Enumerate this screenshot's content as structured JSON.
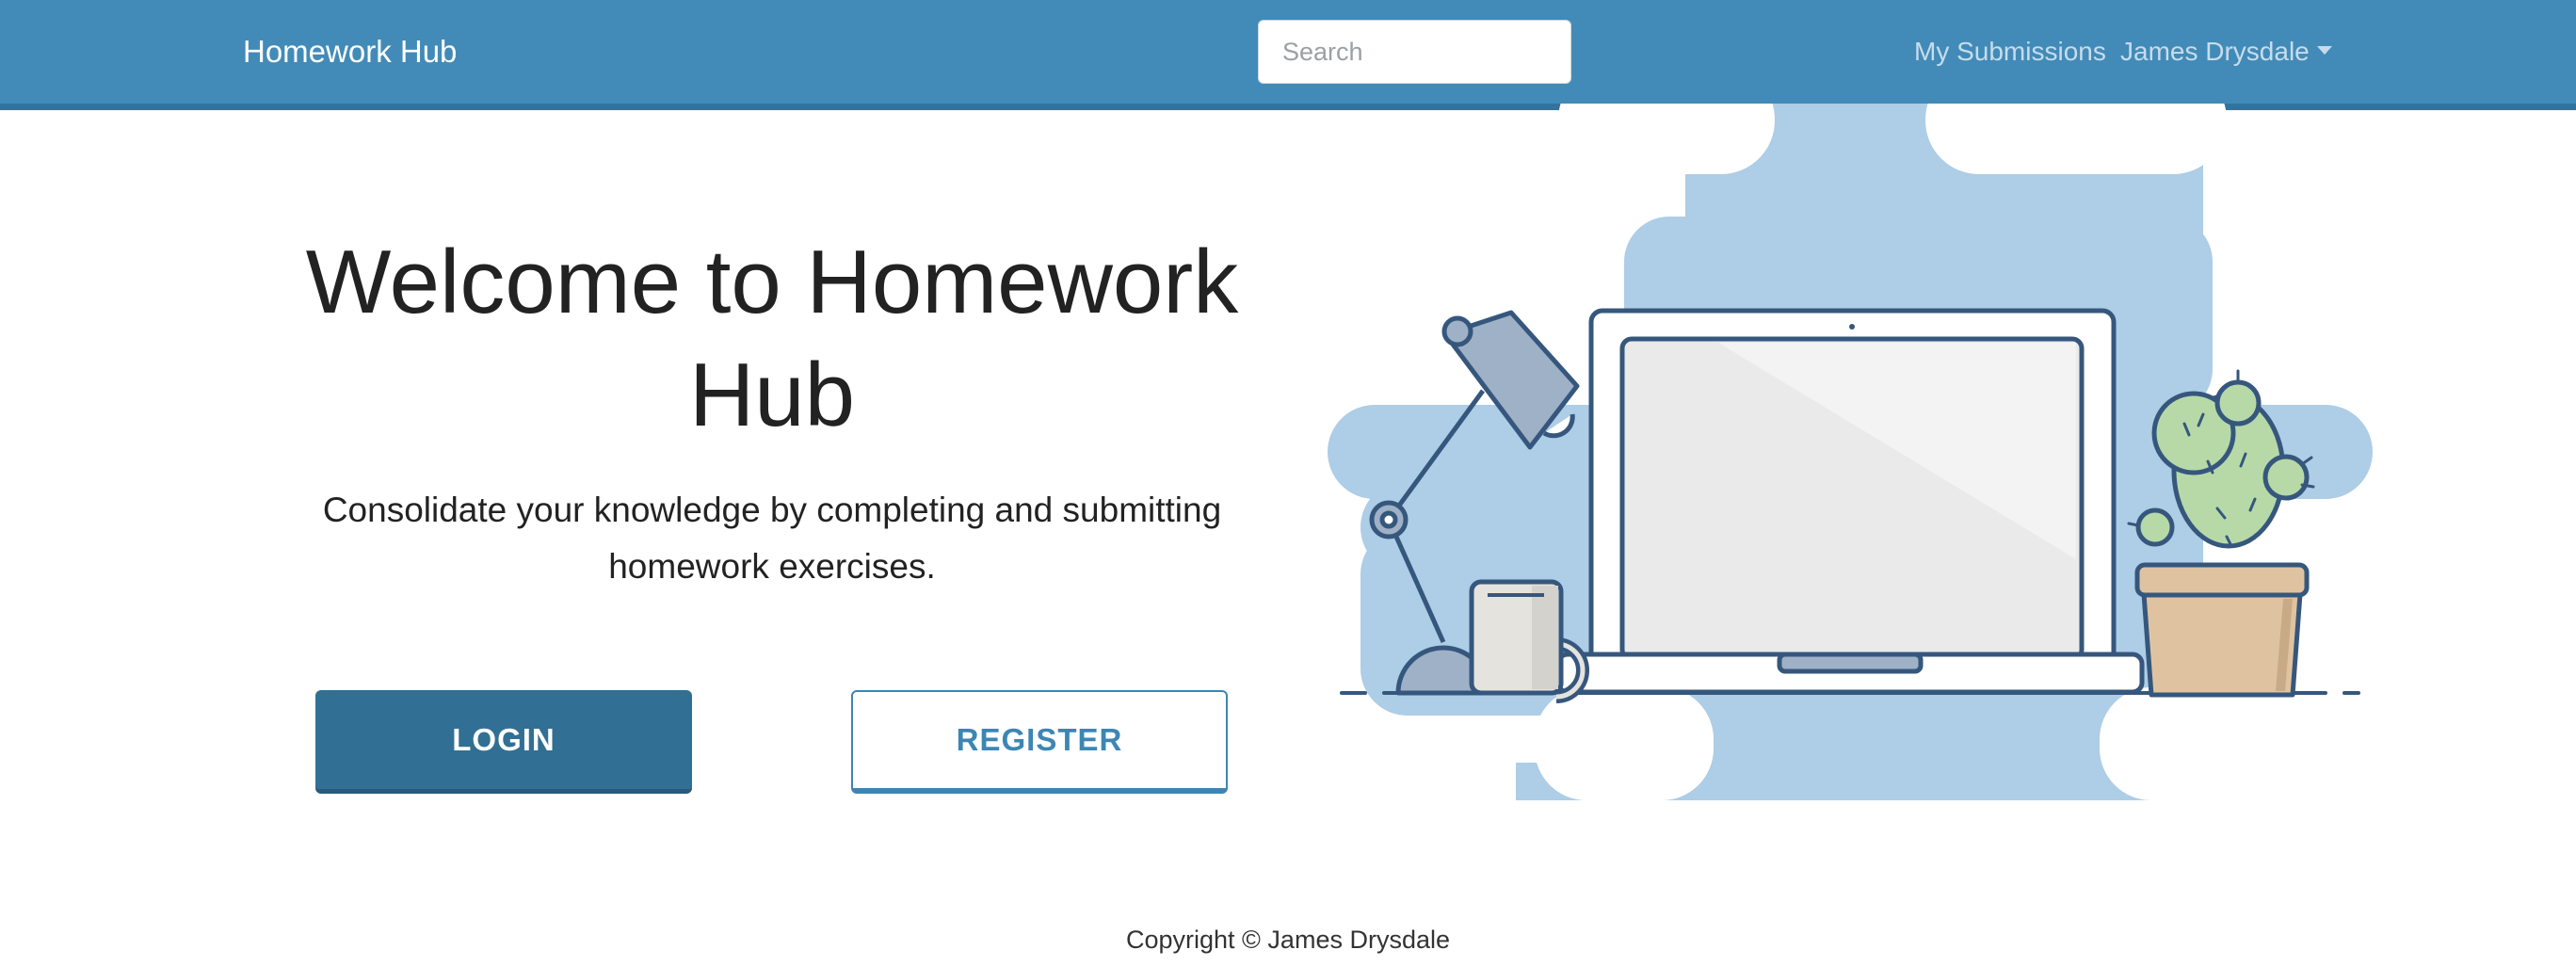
{
  "navbar": {
    "brand": "Homework Hub",
    "search_placeholder": "Search",
    "search_value": "",
    "links": {
      "submissions": "My Submissions",
      "user": "James Drysdale"
    }
  },
  "hero": {
    "title": "Welcome to Homework Hub",
    "subtitle": "Consolidate your knowledge by completing and submitting homework exercises.",
    "login_label": "LOGIN",
    "register_label": "REGISTER"
  },
  "footer": {
    "copyright": "Copyright © James Drysdale"
  },
  "colors": {
    "navbar": "#428bb8",
    "primary_button": "#326f94",
    "accent": "#3d86b3",
    "illustration_bg": "#aecde6",
    "outline": "#36577d"
  },
  "icons": {
    "user_menu": "chevron-down-icon",
    "illustration": "desk-laptop-lamp-mug-cactus-illustration"
  }
}
